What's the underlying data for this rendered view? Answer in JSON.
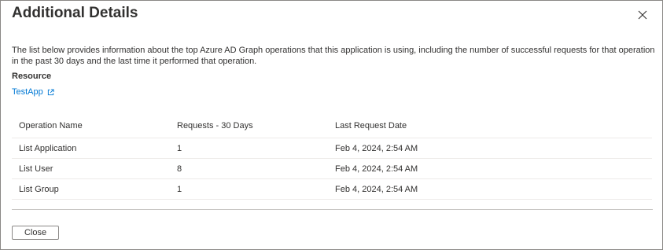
{
  "dialog": {
    "title": "Additional Details",
    "description": "The list below provides information about the top Azure AD Graph operations that this application is using, including the number of successful requests for that operation in the past 30 days and the last time it performed that operation.",
    "resource_label": "Resource",
    "resource_link": "TestApp",
    "close_button_label": "Close"
  },
  "table": {
    "headers": [
      "Operation Name",
      "Requests - 30 Days",
      "Last Request Date"
    ],
    "rows": [
      {
        "operation": "List Application",
        "requests": "1",
        "last_request": "Feb 4, 2024, 2:54 AM"
      },
      {
        "operation": "List User",
        "requests": "8",
        "last_request": "Feb 4, 2024, 2:54 AM"
      },
      {
        "operation": "List Group",
        "requests": "1",
        "last_request": "Feb 4, 2024, 2:54 AM"
      }
    ]
  },
  "icons": {
    "close": "close-icon",
    "external_link": "external-link-icon"
  },
  "colors": {
    "link": "#0078d4",
    "text": "#323130",
    "border": "#8a8886"
  }
}
